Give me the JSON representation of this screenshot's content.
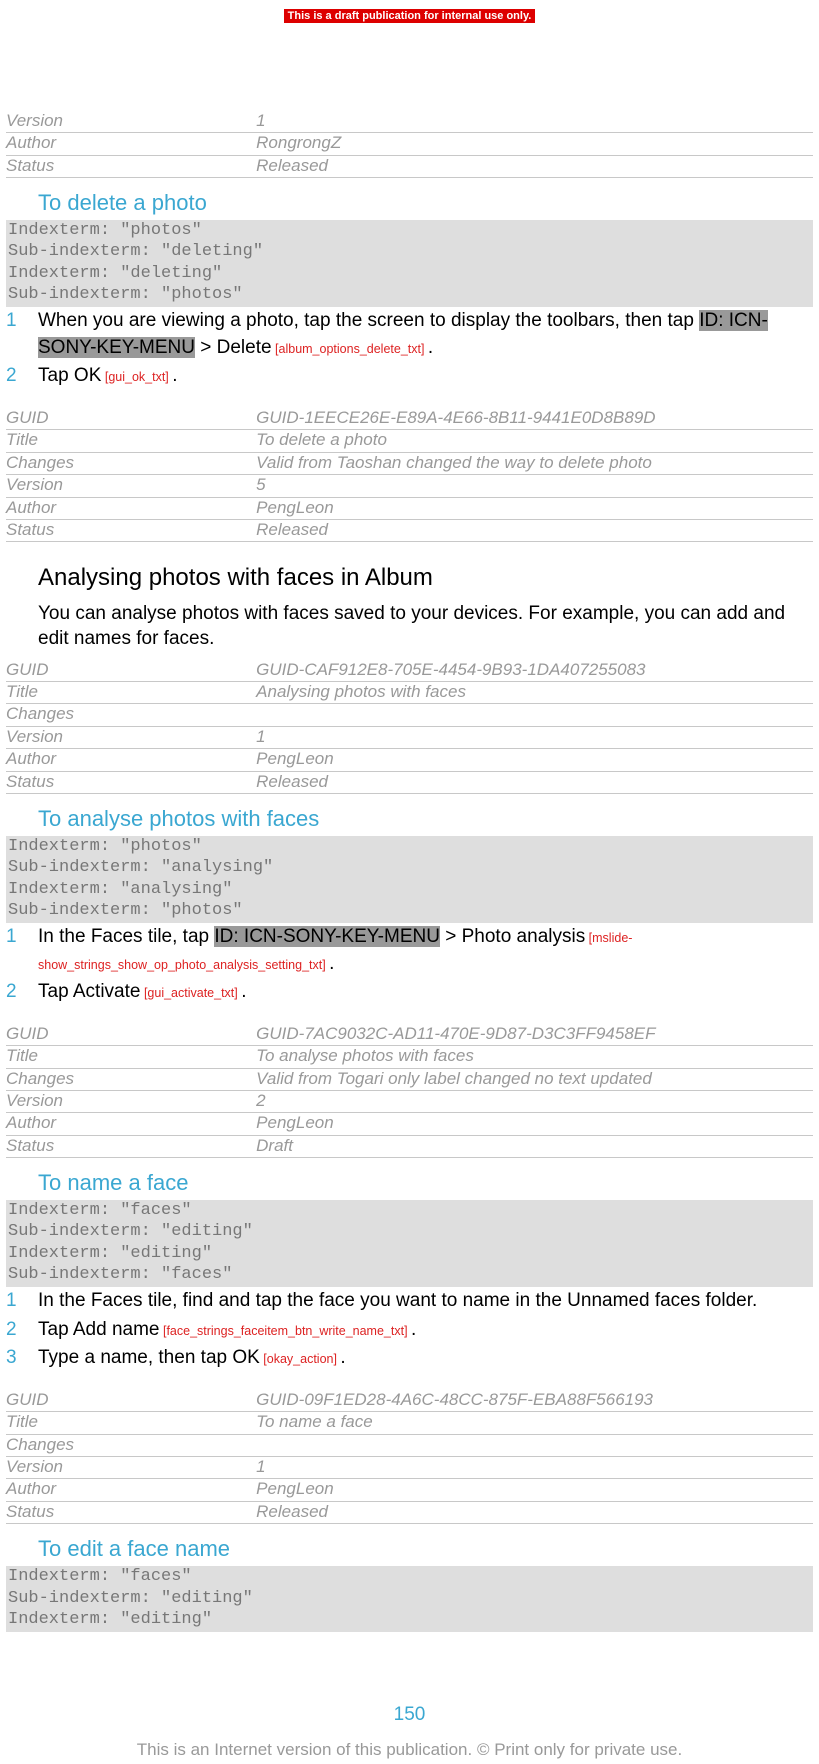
{
  "banner": "This is a draft publication for internal use only.",
  "meta0": {
    "Version": "1",
    "Author": "RongrongZ",
    "Status": "Released"
  },
  "sec1": {
    "heading": "To delete a photo",
    "idx": "Indexterm: \"photos\"\nSub-indexterm: \"deleting\"\nIndexterm: \"deleting\"\nSub-indexterm: \"photos\"",
    "step1a": "When you are viewing a photo, tap the screen to display the toolbars, then tap ",
    "id1": "ID: ICN-SONY-KEY-MENU",
    "step1b": " > ",
    "delete": "Delete",
    "ref1": " [album_options_delete_txt] ",
    "step1c": ".",
    "step2a": "Tap ",
    "ok": "OK",
    "ref2": " [gui_ok_txt] ",
    "step2b": "."
  },
  "meta1": {
    "GUID": "GUID-1EECE26E-E89A-4E66-8B11-9441E0D8B89D",
    "Title": "To delete a photo",
    "Changes": "Valid from Taoshan changed the way to delete photo",
    "Version": "5",
    "Author": "PengLeon",
    "Status": "Released"
  },
  "sec2": {
    "heading": "Analysing photos with faces in Album",
    "para": "You can analyse photos with faces saved to your devices. For example, you can add and edit names for faces."
  },
  "meta2": {
    "GUID": "GUID-CAF912E8-705E-4454-9B93-1DA407255083",
    "Title": "Analysing photos with faces",
    "Changes": "",
    "Version": "1",
    "Author": "PengLeon",
    "Status": "Released"
  },
  "sec3": {
    "heading": "To analyse photos with faces",
    "idx": "Indexterm: \"photos\"\nSub-indexterm: \"analysing\"\nIndexterm: \"analysing\"\nSub-indexterm: \"photos\"",
    "step1a": "In the Faces tile, tap ",
    "id1": "ID: ICN-SONY-KEY-MENU",
    "step1b": " > ",
    "pa": "Photo analysis",
    "ref1": " [mslide-show_strings_show_op_photo_analysis_setting_txt] ",
    "step1c": ".",
    "step2a": "Tap ",
    "act": "Activate",
    "ref2": " [gui_activate_txt] ",
    "step2b": "."
  },
  "meta3": {
    "GUID": "GUID-7AC9032C-AD11-470E-9D87-D3C3FF9458EF",
    "Title": "To analyse photos with faces",
    "Changes": "Valid from Togari only label changed no text updated",
    "Version": "2",
    "Author": "PengLeon",
    "Status": "Draft"
  },
  "sec4": {
    "heading": "To name a face",
    "idx": "Indexterm: \"faces\"\nSub-indexterm: \"editing\"\nIndexterm: \"editing\"\nSub-indexterm: \"faces\"",
    "step1": "In the Faces tile, find and tap the face you want to name in the Unnamed faces folder.",
    "step2a": "Tap ",
    "addname": "Add name",
    "ref2": " [face_strings_faceitem_btn_write_name_txt] ",
    "step2b": ".",
    "step3a": "Type a name, then tap ",
    "ok": "OK",
    "ref3": " [okay_action] ",
    "step3b": "."
  },
  "meta4": {
    "GUID": "GUID-09F1ED28-4A6C-48CC-875F-EBA88F566193",
    "Title": "To name a face",
    "Changes": "",
    "Version": "1",
    "Author": "PengLeon",
    "Status": "Released"
  },
  "sec5": {
    "heading": "To edit a face name",
    "idx": "Indexterm: \"faces\"\nSub-indexterm: \"editing\"\nIndexterm: \"editing\""
  },
  "keys": {
    "GUID": "GUID",
    "Title": "Title",
    "Changes": "Changes",
    "Version": "Version",
    "Author": "Author",
    "Status": "Status"
  },
  "pageNum": "150",
  "footer": "This is an Internet version of this publication. © Print only for private use."
}
